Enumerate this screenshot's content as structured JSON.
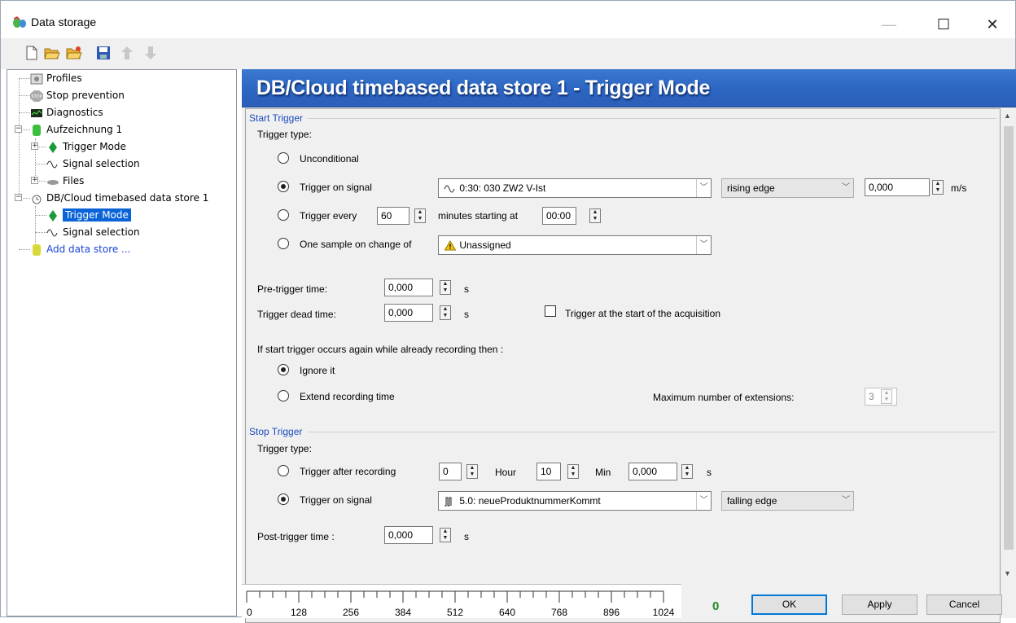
{
  "window": {
    "title": "Data storage",
    "minimize": "—",
    "maximize": "☐",
    "close": "✕"
  },
  "toolbar": [
    "new-icon",
    "open-icon",
    "open-folder-icon",
    "save-icon",
    "move-up-icon",
    "move-down-icon"
  ],
  "tree": [
    {
      "label": "Profiles",
      "icon": "profiles-icon"
    },
    {
      "label": "Stop prevention",
      "icon": "stop-icon"
    },
    {
      "label": "Diagnostics",
      "icon": "diagnostics-icon"
    },
    {
      "label": "Aufzeichnung 1",
      "icon": "datastore-icon"
    },
    {
      "label": "Trigger Mode",
      "icon": "trigger-icon"
    },
    {
      "label": "Signal selection",
      "icon": "signal-icon"
    },
    {
      "label": "Files",
      "icon": "files-icon"
    },
    {
      "label": "DB/Cloud timebased data store 1",
      "icon": "cloud-store-icon"
    },
    {
      "label": "Trigger Mode",
      "icon": "trigger-icon"
    },
    {
      "label": "Signal selection",
      "icon": "signal-icon"
    },
    {
      "label": "Add data store ...",
      "icon": "add-datastore-icon"
    }
  ],
  "header": {
    "title": "DB/Cloud timebased data store 1 - Trigger Mode"
  },
  "start": {
    "section": "Start Trigger",
    "trigger_type": "Trigger type:",
    "unconditional": "Unconditional",
    "on_signal": "Trigger on signal",
    "signal_value": "0:30: 030 ZW2 V-Ist",
    "edge": "rising edge",
    "threshold": "0,000",
    "threshold_unit": "m/s",
    "every": "Trigger every",
    "every_value": "60",
    "minutes_starting_at": "minutes starting at",
    "start_time": "00:00",
    "one_sample": "One sample on change of",
    "unassigned": "Unassigned",
    "pretrigger_label": "Pre-trigger time:",
    "pretrigger_value": "0,000",
    "pretrigger_unit": "s",
    "deadtime_label": "Trigger dead time:",
    "deadtime_value": "0,000",
    "deadtime_unit": "s",
    "start_acq": "Trigger at the start of the acquisition",
    "again_label": "If start trigger occurs again while already recording then :",
    "ignore": "Ignore it",
    "extend": "Extend recording time",
    "max_ext_label": "Maximum number of extensions:",
    "max_ext_value": "3",
    "selected": "on_signal"
  },
  "stop": {
    "section": "Stop Trigger",
    "trigger_type": "Trigger type:",
    "after_recording": "Trigger after recording",
    "hour_value": "0",
    "hour_label": "Hour",
    "min_value": "10",
    "min_label": "Min",
    "sec_value": "0,000",
    "sec_label": "s",
    "on_signal": "Trigger on signal",
    "signal_value": "5.0: neueProduktnummerKommt",
    "edge": "falling edge",
    "posttrigger_label": "Post-trigger time :",
    "posttrigger_value": "0,000",
    "posttrigger_unit": "s",
    "selected": "on_signal"
  },
  "ruler": {
    "labels": [
      "0",
      "128",
      "256",
      "384",
      "512",
      "640",
      "768",
      "896",
      "1024"
    ]
  },
  "footer": {
    "count": "0",
    "ok": "OK",
    "apply": "Apply",
    "cancel": "Cancel"
  },
  "colors": {
    "header": "#2c65c2",
    "section": "#1a4bbf",
    "count": "#1f8a1f",
    "selection": "#0a64d8"
  }
}
